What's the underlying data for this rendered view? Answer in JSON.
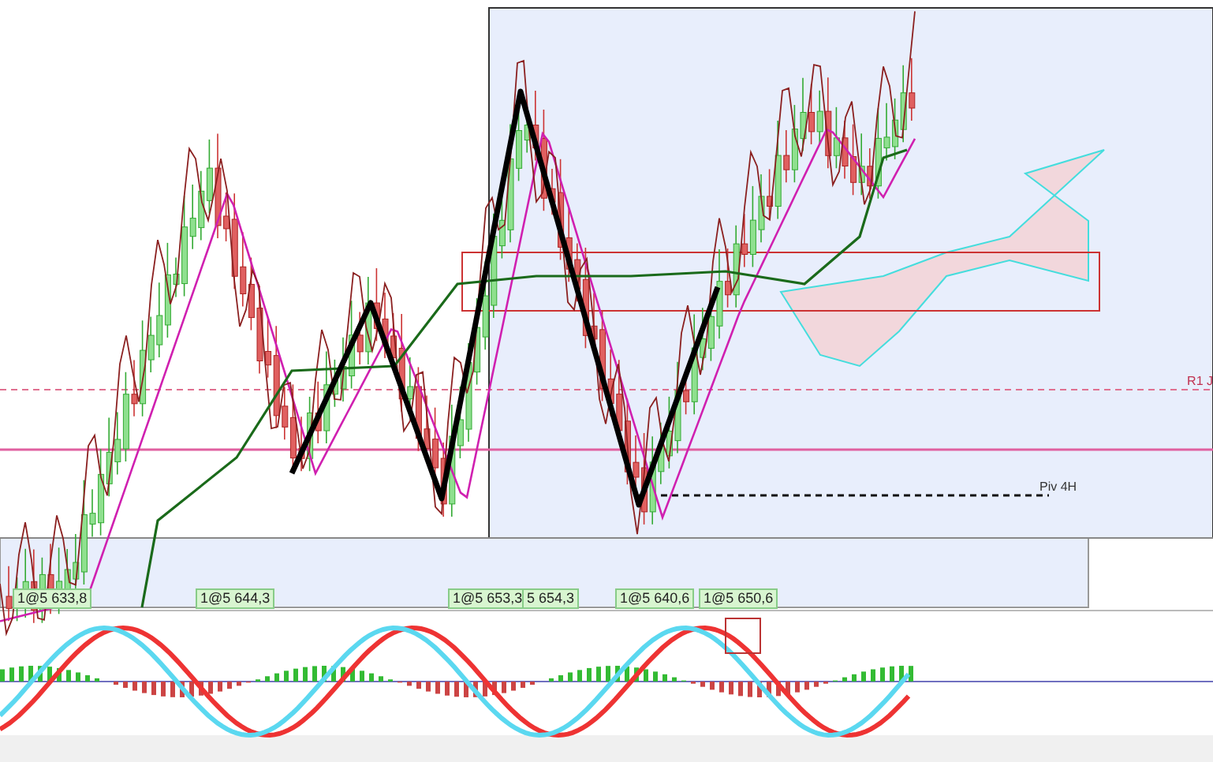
{
  "price_labels": [
    {
      "text": "1@5 633,8"
    },
    {
      "text": "1@5 644,3"
    },
    {
      "text": "1@5 653,3"
    },
    {
      "text": "5 654,3"
    },
    {
      "text": "1@5 640,6"
    },
    {
      "text": "1@5 650,6"
    }
  ],
  "level_labels": [
    {
      "kind": "resistance",
      "text": "R1 J"
    },
    {
      "kind": "pivot",
      "text": "Piv 4H"
    }
  ]
}
